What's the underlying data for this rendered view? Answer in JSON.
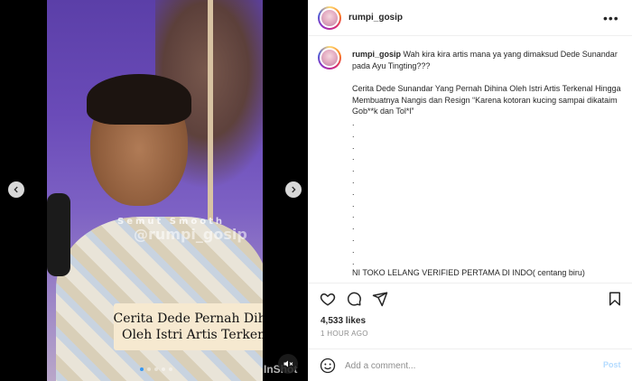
{
  "media": {
    "watermark_top": "Semut Smooth",
    "watermark_handle": "@rumpi_gosip",
    "caption_line1": "Cerita Dede Pernah Dihina",
    "caption_line2": "Oleh Istri Artis Terkenal",
    "app_mark": "InShot",
    "carousel_dots": 5,
    "active_dot": 0
  },
  "post": {
    "username": "rumpi_gosip",
    "more_label": "•••"
  },
  "comment": {
    "username": "rumpi_gosip",
    "text": "Wah kira kira artis mana ya yang dimaksud Dede Sunandar pada Ayu Tingting???",
    "paragraph": "Cerita Dede Sunandar Yang Pernah Dihina Oleh Istri Artis Terkenal Hingga Membuatnya Nangis dan Resign “Karena kotoran kucing sampai dikataim Gob**k dan Tol*l”",
    "dots": [
      ".",
      ".",
      ".",
      ".",
      ".",
      ".",
      ".",
      ".",
      ".",
      ".",
      ".",
      ".",
      "."
    ],
    "footer": "NI TOKO LELANG VERIFIED PERTAMA DI INDO( centang biru)"
  },
  "actions": {
    "icons": [
      "heart-icon",
      "comment-icon",
      "share-icon",
      "bookmark-icon"
    ]
  },
  "likes": "4,533 likes",
  "timestamp": "1 HOUR AGO",
  "add_comment": {
    "placeholder": "Add a comment...",
    "post_label": "Post"
  },
  "colors": {
    "link_blue": "#3897f0",
    "post_disabled": "#b3dbff",
    "text": "#262626",
    "muted": "#8e8e8e"
  }
}
